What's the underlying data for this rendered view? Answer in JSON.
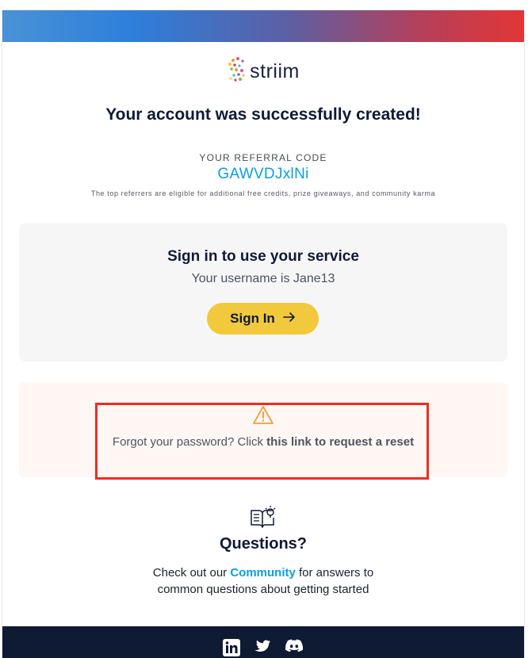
{
  "brand": {
    "name": "striim"
  },
  "header": {
    "title": "Your account was successfully created!"
  },
  "referral": {
    "label": "YOUR REFERRAL CODE",
    "code": "GAWVDJxlNi",
    "note": "The top referrers are eligible for additional free credits, prize giveaways, and community karma"
  },
  "signin": {
    "title": "Sign in to use your service",
    "username_text": "Your username is Jane13",
    "button_label": "Sign In"
  },
  "forgot": {
    "text_prefix": "Forgot your password? Click ",
    "link_text": "this link to request a reset"
  },
  "questions": {
    "title": "Questions?",
    "text_prefix": "Check out our ",
    "community_link": "Community",
    "text_suffix": " for answers to",
    "text_line2": "common questions about getting started"
  },
  "footer": {
    "social": [
      {
        "icon": "linkedin-icon"
      },
      {
        "icon": "twitter-icon"
      },
      {
        "icon": "discord-icon"
      }
    ]
  },
  "colors": {
    "accent_blue": "#0aa0e0",
    "button_yellow": "#f2c83c",
    "highlight_red": "#ee2d1f",
    "footer_navy": "#0f1b33"
  }
}
